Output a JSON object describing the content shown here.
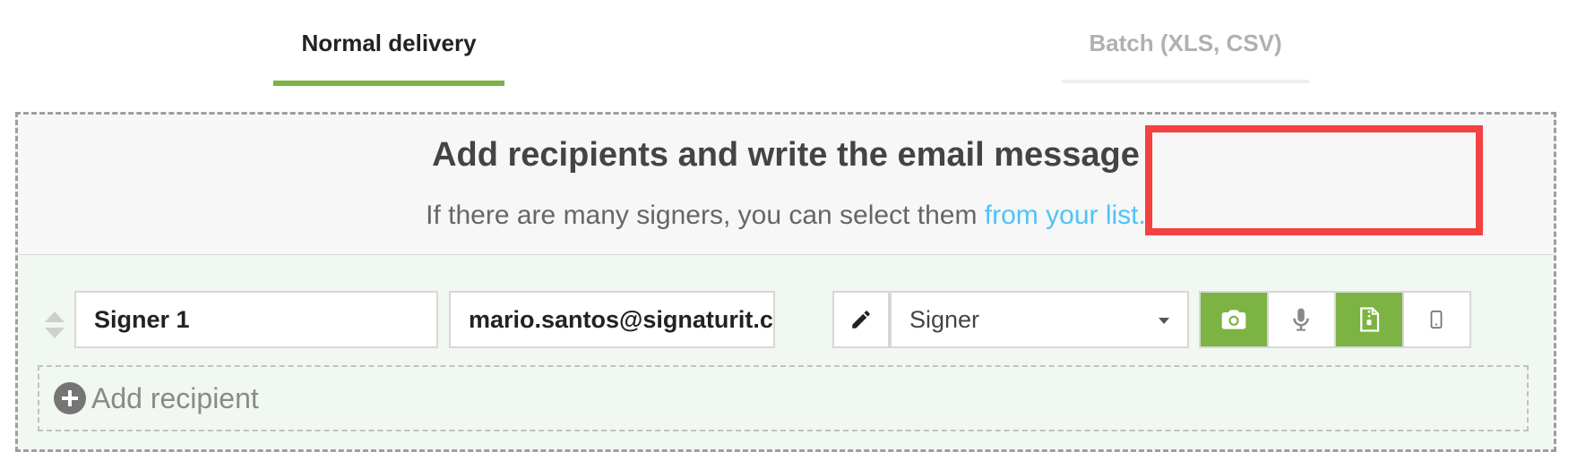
{
  "tabs": [
    {
      "label": "Normal delivery",
      "active": true
    },
    {
      "label": "Batch (XLS, CSV)",
      "active": false
    }
  ],
  "panel": {
    "title": "Add recipients and write the email message",
    "subtitle": "If there are many signers, you can select them ",
    "subtitle_link": "from your list."
  },
  "recipient": {
    "name": "Signer 1",
    "email": "mario.santos@signaturit.com",
    "role": "Signer",
    "options": [
      {
        "icon": "camera-icon",
        "active": true
      },
      {
        "icon": "microphone-icon",
        "active": false
      },
      {
        "icon": "zip-file-icon",
        "active": true
      },
      {
        "icon": "mobile-phone-icon",
        "active": false
      }
    ]
  },
  "add_recipient_label": "Add recipient",
  "colors": {
    "accent": "#7cb342",
    "link": "#4fc3f7",
    "highlight": "#f44141"
  }
}
